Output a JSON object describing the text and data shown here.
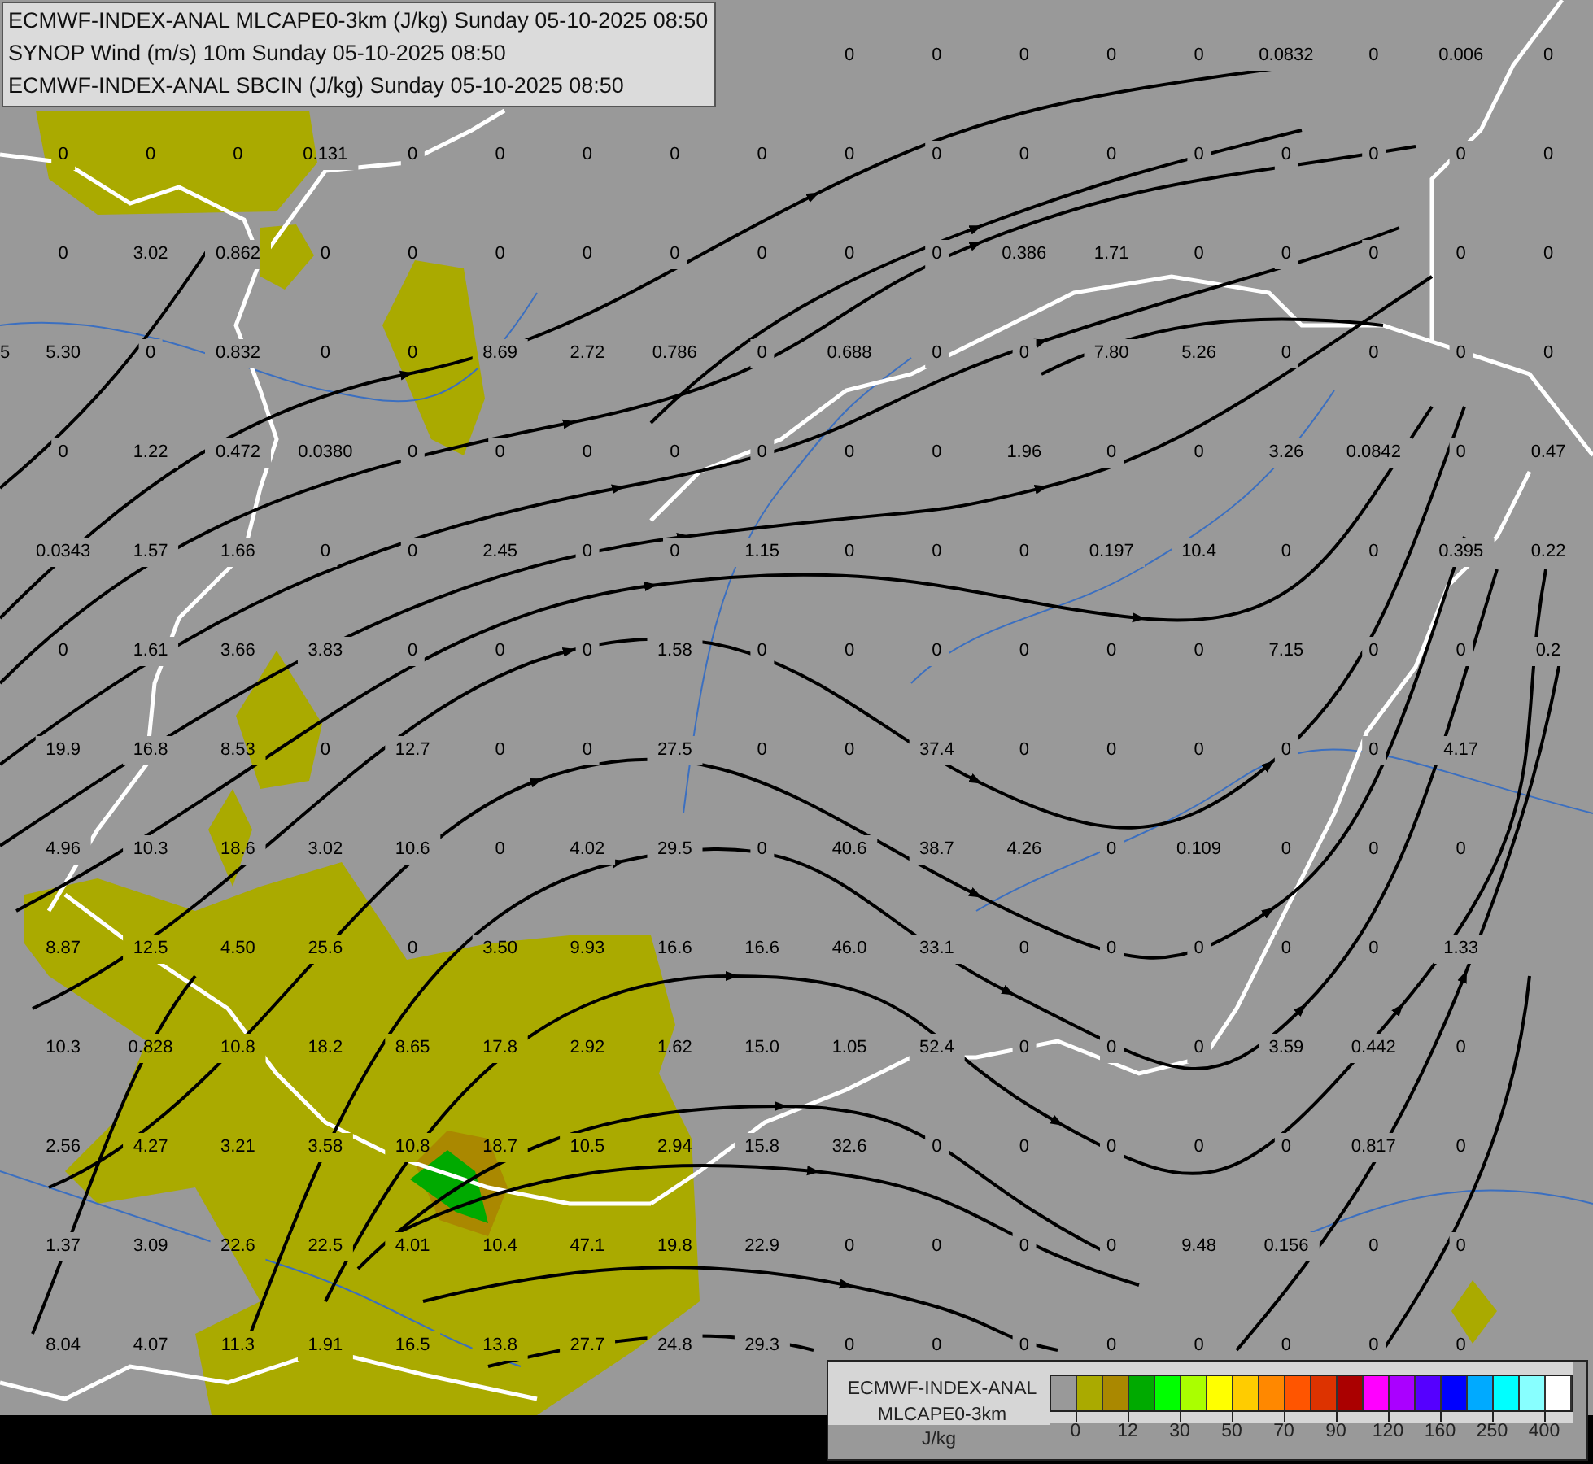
{
  "header": {
    "lines": [
      "ECMWF-INDEX-ANAL MLCAPE0-3km (J/kg) Sunday 05-10-2025 08:50",
      "SYNOP Wind (m/s) 10m Sunday 05-10-2025 08:50",
      "ECMWF-INDEX-ANAL SBCIN (J/kg) Sunday 05-10-2025 08:50"
    ]
  },
  "map": {
    "value_rows": [
      [
        null,
        null,
        null,
        null,
        null,
        null,
        null,
        null,
        null,
        null,
        "0",
        "0",
        "0",
        "0",
        "0",
        "0.0832",
        "0",
        "0.006",
        "0"
      ],
      [
        null,
        "0",
        "0",
        "0",
        "0.131",
        "0",
        "0",
        "0",
        "0",
        "0",
        "0",
        "0",
        "0",
        "0",
        "0",
        "0",
        "0",
        "0",
        "0"
      ],
      [
        null,
        "0",
        "3.02",
        "0.862",
        "0",
        "0",
        "0",
        "0",
        "0",
        "0",
        "0",
        "0",
        "0.386",
        "1.71",
        "0",
        "0",
        "0",
        "0",
        "0"
      ],
      [
        "5",
        "5.30",
        "0",
        "0.832",
        "0",
        "0",
        "8.69",
        "2.72",
        "0.786",
        "0",
        "0.688",
        "0",
        "0",
        "7.80",
        "5.26",
        "0",
        "0",
        "0",
        "0"
      ],
      [
        null,
        "0",
        "1.22",
        "0.472",
        "0.0380",
        "0",
        "0",
        "0",
        "0",
        "0",
        "0",
        "0",
        "1.96",
        "0",
        "0",
        "3.26",
        "0.0842",
        "0",
        "0.47"
      ],
      [
        null,
        "0.0343",
        "1.57",
        "1.66",
        "0",
        "0",
        "2.45",
        "0",
        "0",
        "1.15",
        "0",
        "0",
        "0",
        "0.197",
        "10.4",
        "0",
        "0",
        "0.395",
        "0.22"
      ],
      [
        null,
        "0",
        "1.61",
        "3.66",
        "3.83",
        "0",
        "0",
        "0",
        "1.58",
        "0",
        "0",
        "0",
        "0",
        "0",
        "0",
        "7.15",
        "0",
        "0",
        "0.2"
      ],
      [
        null,
        "19.9",
        "16.8",
        "8.53",
        "0",
        "12.7",
        "0",
        "0",
        "27.5",
        "0",
        "0",
        "37.4",
        "0",
        "0",
        "0",
        "0",
        "0",
        "4.17",
        null
      ],
      [
        null,
        "4.96",
        "10.3",
        "18.6",
        "3.02",
        "10.6",
        "0",
        "4.02",
        "29.5",
        "0",
        "40.6",
        "38.7",
        "4.26",
        "0",
        "0.109",
        "0",
        "0",
        "0",
        null
      ],
      [
        null,
        "8.87",
        "12.5",
        "4.50",
        "25.6",
        "0",
        "3.50",
        "9.93",
        "16.6",
        "16.6",
        "46.0",
        "33.1",
        "0",
        "0",
        "0",
        "0",
        "0",
        "1.33",
        null
      ],
      [
        null,
        "10.3",
        "0.828",
        "10.8",
        "18.2",
        "8.65",
        "17.8",
        "2.92",
        "1.62",
        "15.0",
        "1.05",
        "52.4",
        "0",
        "0",
        "0",
        "3.59",
        "0.442",
        "0",
        null
      ],
      [
        null,
        "2.56",
        "4.27",
        "3.21",
        "3.58",
        "10.8",
        "18.7",
        "10.5",
        "2.94",
        "15.8",
        "32.6",
        "0",
        "0",
        "0",
        "0",
        "0",
        "0.817",
        "0",
        null
      ],
      [
        null,
        "1.37",
        "3.09",
        "22.6",
        "22.5",
        "4.01",
        "10.4",
        "47.1",
        "19.8",
        "22.9",
        "0",
        "0",
        "0",
        "0",
        "9.48",
        "0.156",
        "0",
        "0",
        null
      ],
      [
        null,
        "8.04",
        "4.07",
        "11.3",
        "1.91",
        "16.5",
        "13.8",
        "27.7",
        "24.8",
        "29.3",
        "0",
        "0",
        "0",
        "0",
        "0",
        "0",
        "0",
        "0",
        null
      ]
    ]
  },
  "legend": {
    "title_lines": [
      "ECMWF-INDEX-ANAL",
      "MLCAPE0-3km"
    ],
    "unit": "J/kg",
    "swatches": [
      {
        "color": "#999999"
      },
      {
        "color": "#aaaa00"
      },
      {
        "color": "#aa8800"
      },
      {
        "color": "#00aa00"
      },
      {
        "color": "#00ff00"
      },
      {
        "color": "#aaff00"
      },
      {
        "color": "#ffff00"
      },
      {
        "color": "#ffcc00"
      },
      {
        "color": "#ff8800"
      },
      {
        "color": "#ff5500"
      },
      {
        "color": "#dd3300"
      },
      {
        "color": "#aa0000"
      },
      {
        "color": "#ff00ff"
      },
      {
        "color": "#aa00ff"
      },
      {
        "color": "#5500ff"
      },
      {
        "color": "#0000ff"
      },
      {
        "color": "#00aaff"
      },
      {
        "color": "#00ffff"
      },
      {
        "color": "#88ffff"
      },
      {
        "color": "#ffffff"
      }
    ],
    "labels": [
      "0",
      "12",
      "30",
      "50",
      "70",
      "90",
      "120",
      "160",
      "250",
      "400"
    ]
  }
}
